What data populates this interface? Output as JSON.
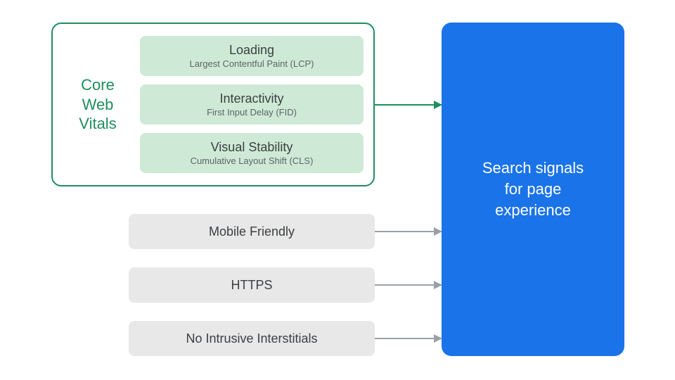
{
  "cwv": {
    "label_line1": "Core",
    "label_line2": "Web",
    "label_line3": "Vitals",
    "metrics": [
      {
        "title": "Loading",
        "sub": "Largest Contentful Paint (LCP)"
      },
      {
        "title": "Interactivity",
        "sub": "First Input Delay (FID)"
      },
      {
        "title": "Visual Stability",
        "sub": "Cumulative Layout Shift (CLS)"
      }
    ]
  },
  "signals": [
    {
      "label": "Mobile Friendly"
    },
    {
      "label": "HTTPS"
    },
    {
      "label": "No Intrusive Interstitials"
    }
  ],
  "panel": {
    "line1": "Search signals",
    "line2": "for page",
    "line3": "experience"
  }
}
